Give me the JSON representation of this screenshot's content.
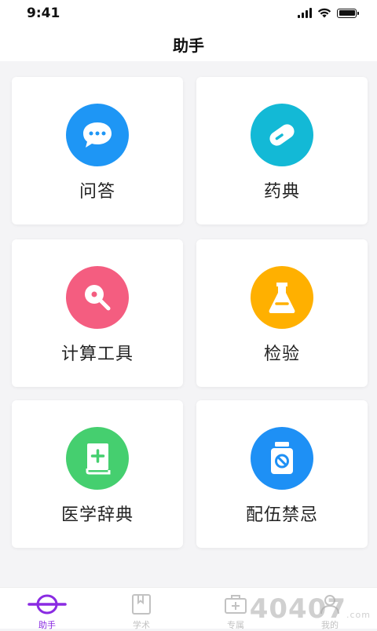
{
  "status_bar": {
    "time": "9:41"
  },
  "header": {
    "title": "助手"
  },
  "cards": [
    {
      "label": "问答",
      "icon": "chat-bubble-icon",
      "color": "#1e96f5"
    },
    {
      "label": "药典",
      "icon": "pill-icon",
      "color": "#13b9d6"
    },
    {
      "label": "计算工具",
      "icon": "search-calc-icon",
      "color": "#f45d80"
    },
    {
      "label": "检验",
      "icon": "flask-icon",
      "color": "#ffb000"
    },
    {
      "label": "医学辞典",
      "icon": "medical-book-icon",
      "color": "#45cf6f"
    },
    {
      "label": "配伍禁忌",
      "icon": "prohibited-bottle-icon",
      "color": "#1e90f5"
    }
  ],
  "tabbar": {
    "active_color": "#8a2be2",
    "inactive_color": "#c2c2c2",
    "tabs": [
      {
        "label": "助手",
        "icon": "assistant-icon",
        "active": true
      },
      {
        "label": "学术",
        "icon": "bookmark-book-icon",
        "active": false
      },
      {
        "label": "专属",
        "icon": "medical-kit-icon",
        "active": false
      },
      {
        "label": "我的",
        "icon": "profile-icon",
        "active": false
      }
    ]
  },
  "watermark": {
    "text": "40407",
    "suffix": ".com"
  }
}
